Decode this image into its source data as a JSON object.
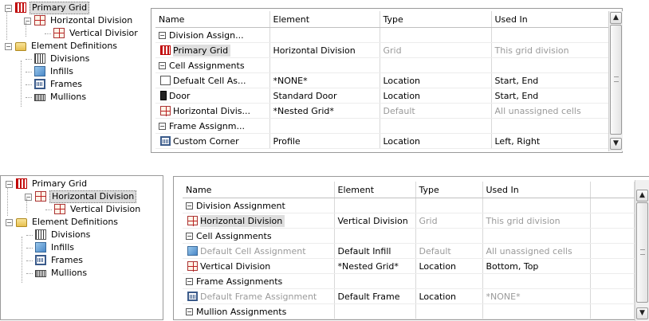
{
  "top": {
    "tree": [
      {
        "label": "Primary Grid",
        "icon": "primary-grid-icon",
        "selected": true
      },
      {
        "label": "Horizontal Division",
        "icon": "horizontal-division-icon"
      },
      {
        "label": "Vertical Divisior",
        "icon": "vertical-division-icon"
      },
      {
        "label": "Element Definitions",
        "icon": "folder-icon"
      },
      {
        "label": "Divisions",
        "icon": "divisions-icon"
      },
      {
        "label": "Infills",
        "icon": "infill-icon"
      },
      {
        "label": "Frames",
        "icon": "frame-icon"
      },
      {
        "label": "Mullions",
        "icon": "mullion-icon"
      }
    ],
    "columns": [
      "Name",
      "Element",
      "Type",
      "Used In"
    ],
    "rows": [
      {
        "group": "Division Assign..."
      },
      {
        "name": "Primary Grid",
        "icon": "primary-grid-icon",
        "element": "Horizontal Division",
        "type": "Grid",
        "used_in": "This grid division",
        "type_gray": true,
        "used_gray": true,
        "highlight": true
      },
      {
        "group": "Cell Assignments"
      },
      {
        "name": "Defualt Cell As...",
        "icon": "document-icon",
        "element": "*NONE*",
        "type": "Location",
        "used_in": "Start, End"
      },
      {
        "name": "Door",
        "icon": "door-icon",
        "element": "Standard Door",
        "type": "Location",
        "used_in": "Start, End"
      },
      {
        "name": "Horizontal Divis...",
        "icon": "horizontal-division-icon",
        "element": "*Nested Grid*",
        "type": "Default",
        "used_in": "All unassigned cells",
        "type_gray": true,
        "used_gray": true
      },
      {
        "group": "Frame Assignm..."
      },
      {
        "name": "Custom Corner",
        "icon": "frame-icon",
        "element": "Profile",
        "type": "Location",
        "used_in": "Left, Right"
      }
    ]
  },
  "bottom": {
    "tree": [
      {
        "label": "Primary Grid",
        "icon": "primary-grid-icon"
      },
      {
        "label": "Horizontal Division",
        "icon": "horizontal-division-icon",
        "selected": true
      },
      {
        "label": "Vertical Division",
        "icon": "vertical-division-icon"
      },
      {
        "label": "Element Definitions",
        "icon": "folder-icon"
      },
      {
        "label": "Divisions",
        "icon": "divisions-icon"
      },
      {
        "label": "Infills",
        "icon": "infill-icon"
      },
      {
        "label": "Frames",
        "icon": "frame-icon"
      },
      {
        "label": "Mullions",
        "icon": "mullion-icon"
      }
    ],
    "columns": [
      "Name",
      "Element",
      "Type",
      "Used In"
    ],
    "rows": [
      {
        "group": "Division Assignment"
      },
      {
        "name": "Horizontal Division",
        "icon": "horizontal-division-icon",
        "element": "Vertical Division",
        "type": "Grid",
        "used_in": "This grid division",
        "type_gray": true,
        "used_gray": true,
        "highlight": true
      },
      {
        "group": "Cell Assignments"
      },
      {
        "name": "Default Cell Assignment",
        "icon": "infill-icon",
        "element": "Default Infill",
        "type": "Default",
        "used_in": "All unassigned cells",
        "name_gray": true,
        "type_gray": true,
        "used_gray": true
      },
      {
        "name": "Vertical Division",
        "icon": "horizontal-division-icon",
        "element": "*Nested Grid*",
        "type": "Location",
        "used_in": "Bottom, Top"
      },
      {
        "group": "Frame Assignments"
      },
      {
        "name": "Default Frame Assignment",
        "icon": "frame-icon",
        "element": "Default Frame",
        "type": "Location",
        "used_in": "*NONE*",
        "name_gray": true,
        "used_gray": true
      },
      {
        "group": "Mullion Assignments"
      }
    ]
  },
  "colors": {
    "grid_red": "#c41010",
    "selection_gray": "#dcdcdc",
    "disabled_text": "#9a9a9a"
  }
}
